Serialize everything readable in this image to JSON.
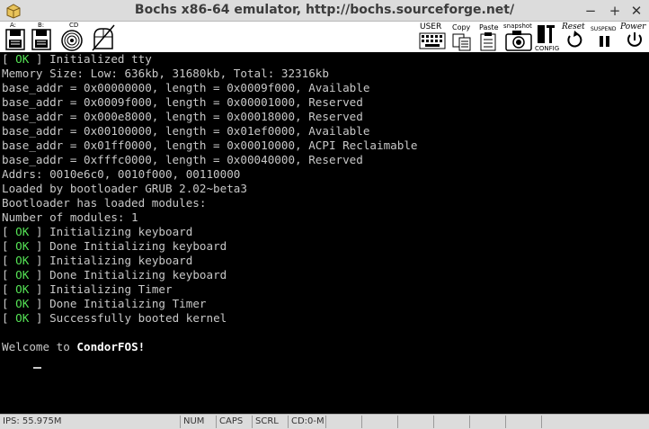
{
  "window": {
    "title": "Bochs x86-64 emulator, http://bochs.sourceforge.net/",
    "minimize_glyph": "−",
    "maximize_glyph": "+",
    "close_glyph": "✕"
  },
  "toolbar": {
    "floppy_a_label": "A:",
    "floppy_b_label": "B:",
    "cdrom_label": "CD",
    "user_label": "USER",
    "copy_label": "Copy",
    "paste_label": "Paste",
    "snapshot_label": "snapshot",
    "config_label": "CONFIG",
    "reset_label": "Reset",
    "suspend_label": "SUSPEND",
    "power_label": "Power"
  },
  "console": {
    "ok_tag": "OK",
    "lines": [
      {
        "ok": true,
        "text": "Initialized tty"
      },
      {
        "ok": false,
        "text": "Memory Size: Low: 636kb, 31680kb, Total: 32316kb"
      },
      {
        "ok": false,
        "text": "base_addr = 0x00000000, length = 0x0009f000, Available"
      },
      {
        "ok": false,
        "text": "base_addr = 0x0009f000, length = 0x00001000, Reserved"
      },
      {
        "ok": false,
        "text": "base_addr = 0x000e8000, length = 0x00018000, Reserved"
      },
      {
        "ok": false,
        "text": "base_addr = 0x00100000, length = 0x01ef0000, Available"
      },
      {
        "ok": false,
        "text": "base_addr = 0x01ff0000, length = 0x00010000, ACPI Reclaimable"
      },
      {
        "ok": false,
        "text": "base_addr = 0xfffc0000, length = 0x00040000, Reserved"
      },
      {
        "ok": false,
        "text": "Addrs: 0010e6c0, 0010f000, 00110000"
      },
      {
        "ok": false,
        "text": "Loaded by bootloader GRUB 2.02~beta3"
      },
      {
        "ok": false,
        "text": "Bootloader has loaded modules:"
      },
      {
        "ok": false,
        "text": "Number of modules: 1"
      },
      {
        "ok": true,
        "text": "Initializing keyboard"
      },
      {
        "ok": true,
        "text": "Done Initializing keyboard"
      },
      {
        "ok": true,
        "text": "Initializing keyboard"
      },
      {
        "ok": true,
        "text": "Done Initializing keyboard"
      },
      {
        "ok": true,
        "text": "Initializing Timer"
      },
      {
        "ok": true,
        "text": "Done Initializing Timer"
      },
      {
        "ok": true,
        "text": "Successfully booted kernel"
      },
      {
        "ok": false,
        "text": ""
      }
    ],
    "welcome_prefix": "Welcome to ",
    "welcome_name": "CondorFOS!"
  },
  "statusbar": {
    "ips": "IPS: 55.975M",
    "num": "NUM",
    "caps": "CAPS",
    "scrl": "SCRL",
    "cd": "CD:0-M"
  }
}
